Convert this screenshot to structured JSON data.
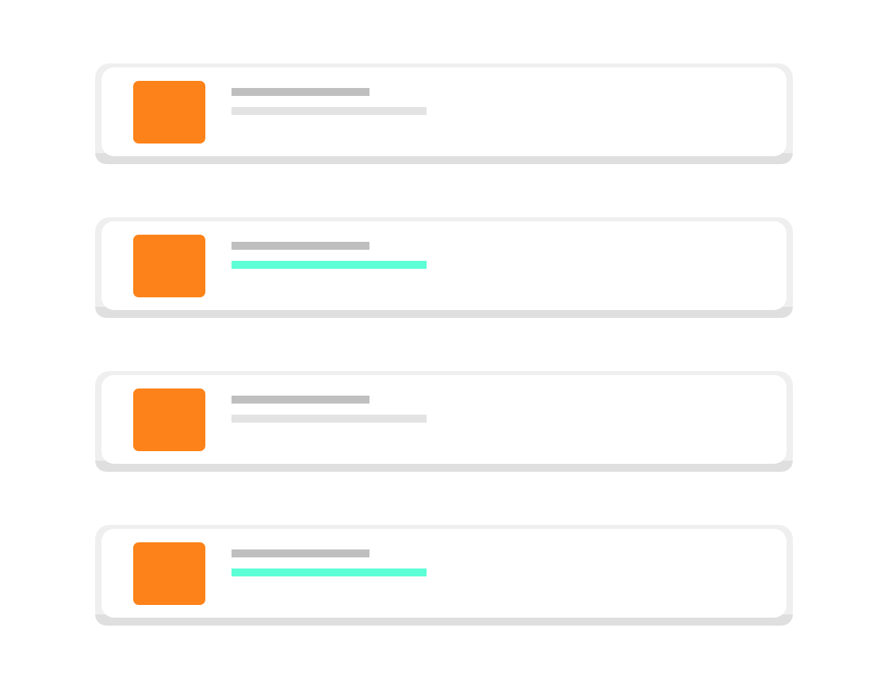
{
  "colors": {
    "thumbnail": "#fd8219",
    "title_line": "#bfbfbf",
    "subtitle_line_default": "#e3e3e3",
    "subtitle_line_highlight": "#5dffd6"
  },
  "items": [
    {
      "thumbnail_icon": "image-placeholder",
      "highlighted": false
    },
    {
      "thumbnail_icon": "image-placeholder",
      "highlighted": true
    },
    {
      "thumbnail_icon": "image-placeholder",
      "highlighted": false
    },
    {
      "thumbnail_icon": "image-placeholder",
      "highlighted": true
    }
  ]
}
